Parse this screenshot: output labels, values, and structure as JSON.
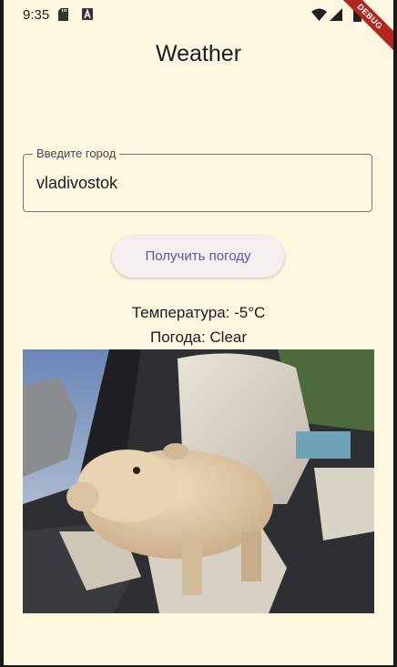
{
  "status_bar": {
    "time": "9:35",
    "icons": [
      "sd-card-icon",
      "a-icon",
      "wifi-icon",
      "signal-icon",
      "battery-icon"
    ],
    "debug_banner": "DEBUG"
  },
  "app_bar": {
    "title": "Weather"
  },
  "form": {
    "city_label": "Введите город",
    "city_value": "vladivostok",
    "button_label": "Получить погоду"
  },
  "result": {
    "temperature": "Температура: -5°C",
    "condition": "Погода: Clear"
  },
  "colors": {
    "background": "#fef7e0",
    "primary": "#6750a4",
    "button_bg": "#f5efef",
    "debug_banner": "#b3261e"
  }
}
